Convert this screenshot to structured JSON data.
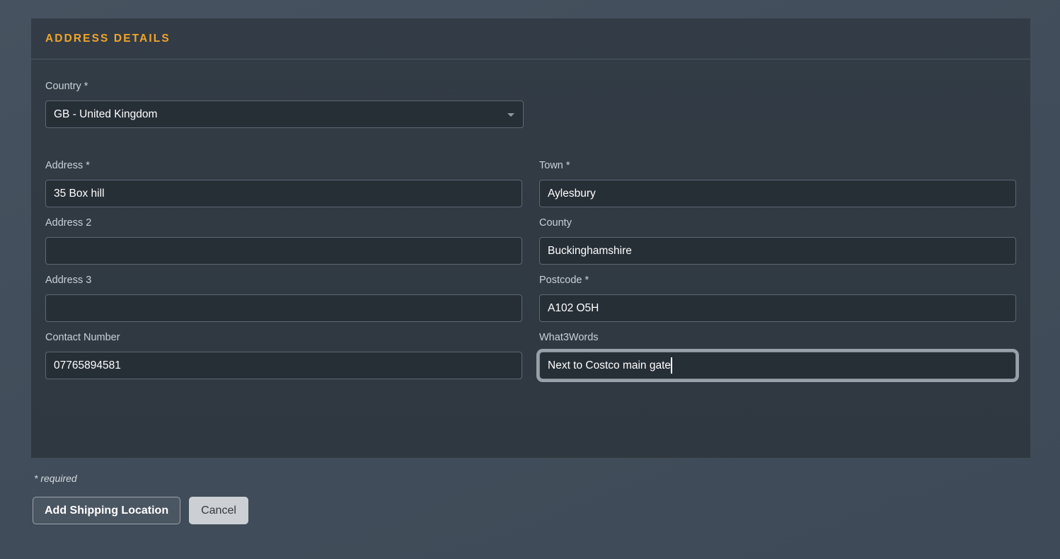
{
  "card": {
    "title": "ADDRESS DETAILS"
  },
  "form": {
    "country": {
      "label": "Country *",
      "value": "GB - United Kingdom",
      "options": [
        "GB - United Kingdom"
      ],
      "caret_icon": "chevron-down-icon"
    },
    "address": {
      "label": "Address *",
      "value": "35 Box hill",
      "placeholder": ""
    },
    "address2": {
      "label": "Address 2",
      "value": "",
      "placeholder": ""
    },
    "address3": {
      "label": "Address 3",
      "value": "",
      "placeholder": ""
    },
    "contact_number": {
      "label": "Contact Number",
      "value": "07765894581",
      "placeholder": ""
    },
    "town": {
      "label": "Town *",
      "value": "Aylesbury",
      "placeholder": ""
    },
    "county": {
      "label": "County",
      "value": "Buckinghamshire",
      "placeholder": ""
    },
    "postcode": {
      "label": "Postcode *",
      "value": "A102 O5H",
      "placeholder": ""
    },
    "what3words": {
      "label": "What3Words",
      "value": "Next to Costco main gate",
      "placeholder": "",
      "focused": true
    }
  },
  "footer": {
    "required_note": "* required",
    "submit_label": "Add Shipping Location",
    "cancel_label": "Cancel"
  },
  "colors": {
    "accent": "#f0a52b",
    "card_bg": "#303a44",
    "page_bg": "#434f5c",
    "input_bg": "#262e36",
    "input_border": "#5d6873",
    "focus_ring": "#98a1aa",
    "label": "#c9d0d7",
    "cancel_bg": "#ccd0d4"
  }
}
